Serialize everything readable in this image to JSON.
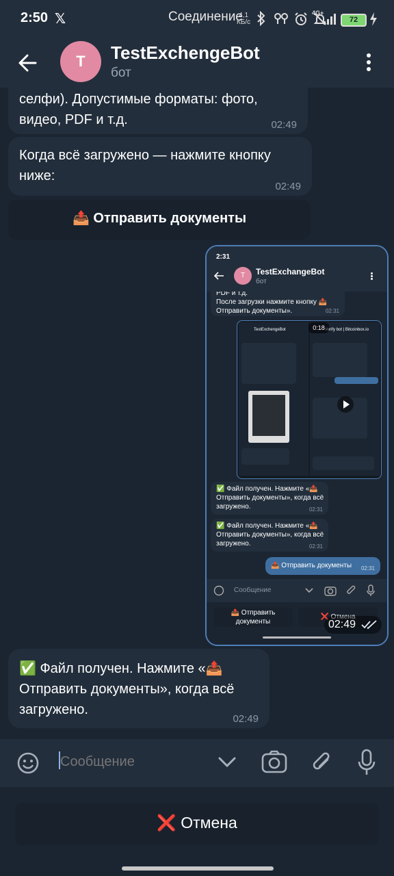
{
  "status": {
    "time": "2:50",
    "x_glyph": "𝕏",
    "connection": "Соединение",
    "speed_value": "4,1",
    "speed_unit": "КБ/с",
    "signal_label": "4G+",
    "battery": "72"
  },
  "header": {
    "avatar_letter": "T",
    "title": "TestExchengeBot",
    "subtitle": "бот"
  },
  "messages": {
    "m1": {
      "text": "селфи). Допустимые форматы: фото, видео, PDF и т.д.",
      "time": "02:49"
    },
    "m2": {
      "text": "Когда всё загружено — нажмите кнопку ниже:",
      "time": "02:49"
    },
    "inline_button": "📤 Отправить документы",
    "screenshot": {
      "status_time": "2:31",
      "title": "TestExchangeBot",
      "subtitle": "бот",
      "msg_top": "PDF и т.д.\nПосле загрузки нажмите кнопку 📤\nОтправить документы».",
      "msg_top_time": "02:31",
      "file_msg": "✅ Файл получен. Нажмите «📤\nОтправить документы», когда всё\nзагружено.",
      "file_time": "02:31",
      "sent_button": "📤 Отправить документы",
      "sent_time": "02:31",
      "input_placeholder": "Сообщение",
      "btn_send": "📤 Отправить\nдокументы",
      "btn_cancel": "❌ Отмена",
      "video_time": "0:18",
      "inner_left_title": "TestExchengeBot",
      "inner_right_title": "Verify bot | Bitcoinbox.io"
    },
    "screenshot_time": "02:49",
    "m3": {
      "text": "✅ Файл получен. Нажмите «📤 Отправить документы», когда всё загружено.",
      "time": "02:49"
    }
  },
  "input": {
    "placeholder": "Сообщение"
  },
  "keyboard": {
    "cancel": "❌ Отмена"
  },
  "icons": [
    "back-arrow-icon",
    "kebab-menu-icon",
    "emoji-icon",
    "chevron-down-icon",
    "camera-icon",
    "paperclip-icon",
    "microphone-icon",
    "bluetooth-icon",
    "alarm-icon",
    "mute-icon",
    "signal-icon",
    "battery-icon",
    "double-check-icon"
  ]
}
